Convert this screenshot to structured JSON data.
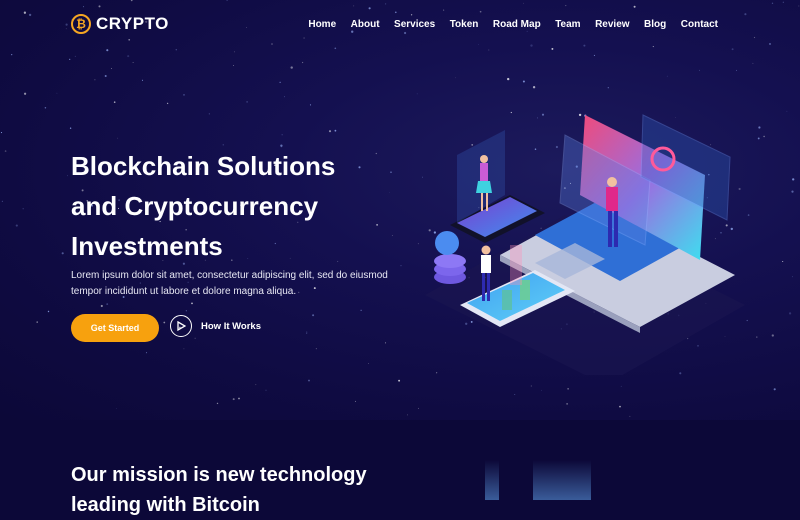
{
  "header": {
    "logo_icon": "bitcoin-icon",
    "logo_text": "CRYPTO",
    "nav": [
      "Home",
      "About",
      "Services",
      "Token",
      "Road Map",
      "Team",
      "Review",
      "Blog",
      "Contact"
    ]
  },
  "hero": {
    "headline_lines": [
      "Blockchain Solutions",
      "and Cryptocurrency",
      "Investments"
    ],
    "subtext": "Lorem ipsum dolor sit amet, consectetur adipiscing elit, sed do eiusmod tempor incididunt ut labore et dolore magna aliqua.",
    "primary_button": "Get Started",
    "secondary_button": "How It Works",
    "secondary_icon": "play-icon",
    "illustration": "isometric-crypto-laptop-illustration"
  },
  "mission": {
    "heading": "Our mission is new technology leading with Bitcoin"
  },
  "colors": {
    "background": "#0c0838",
    "accent": "#f7a10e",
    "logo_accent": "#f5a623"
  }
}
